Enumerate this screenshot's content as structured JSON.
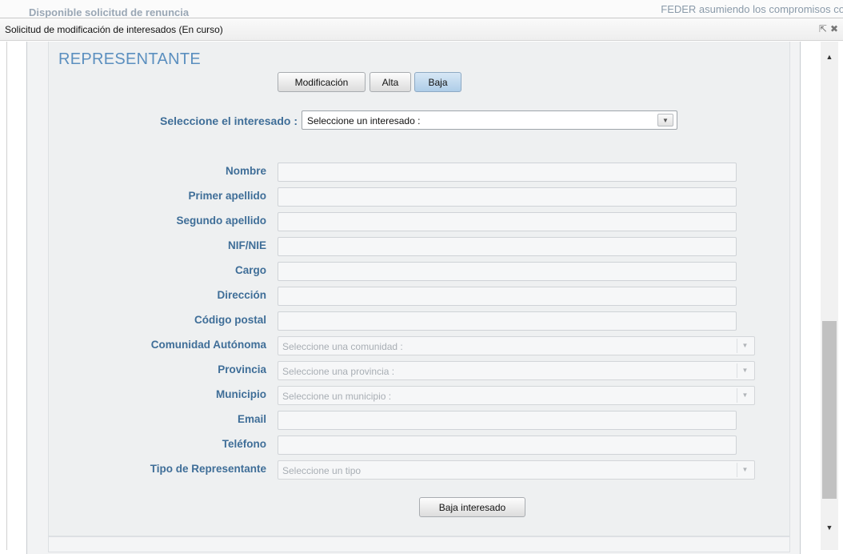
{
  "background": {
    "left_text": "Disponible solicitud de renuncia",
    "right_text": "FEDER asumiendo los compromisos co"
  },
  "dialog": {
    "title": "Solicitud de modificación de interesados (En curso)",
    "icons": [
      "popout-icon",
      "close-icon"
    ]
  },
  "section": {
    "title": "REPRESENTANTE"
  },
  "mode_buttons": {
    "modificacion": "Modificación",
    "alta": "Alta",
    "baja": "Baja",
    "selected": "Baja"
  },
  "selector": {
    "label": "Seleccione el interesado :",
    "value": "Seleccione un interesado :"
  },
  "form": {
    "nombre_label": "Nombre",
    "primer_apellido_label": "Primer apellido",
    "segundo_apellido_label": "Segundo apellido",
    "nif_label": "NIF/NIE",
    "cargo_label": "Cargo",
    "direccion_label": "Dirección",
    "codigo_postal_label": "Código postal",
    "comunidad_label": "Comunidad Autónoma",
    "comunidad_value": "Seleccione una comunidad :",
    "provincia_label": "Provincia",
    "provincia_value": "Seleccione una provincia :",
    "municipio_label": "Municipio",
    "municipio_value": "Seleccione un municipio :",
    "email_label": "Email",
    "telefono_label": "Teléfono",
    "tipo_label": "Tipo de Representante",
    "tipo_value": "Seleccione un tipo"
  },
  "actions": {
    "baja_interesado": "Baja interesado"
  },
  "colors": {
    "label": "#3f6e98",
    "section_title": "#5b8fbf",
    "active_button": "#aecde8"
  }
}
